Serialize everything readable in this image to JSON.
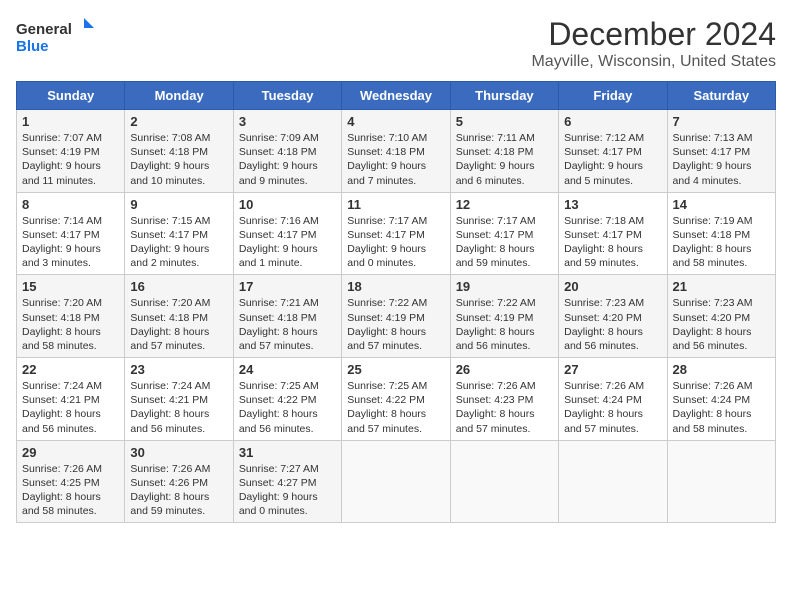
{
  "header": {
    "logo_line1": "General",
    "logo_line2": "Blue",
    "title": "December 2024",
    "location": "Mayville, Wisconsin, United States"
  },
  "days_of_week": [
    "Sunday",
    "Monday",
    "Tuesday",
    "Wednesday",
    "Thursday",
    "Friday",
    "Saturday"
  ],
  "weeks": [
    [
      {
        "day": 1,
        "lines": [
          "Sunrise: 7:07 AM",
          "Sunset: 4:19 PM",
          "Daylight: 9 hours",
          "and 11 minutes."
        ]
      },
      {
        "day": 2,
        "lines": [
          "Sunrise: 7:08 AM",
          "Sunset: 4:18 PM",
          "Daylight: 9 hours",
          "and 10 minutes."
        ]
      },
      {
        "day": 3,
        "lines": [
          "Sunrise: 7:09 AM",
          "Sunset: 4:18 PM",
          "Daylight: 9 hours",
          "and 9 minutes."
        ]
      },
      {
        "day": 4,
        "lines": [
          "Sunrise: 7:10 AM",
          "Sunset: 4:18 PM",
          "Daylight: 9 hours",
          "and 7 minutes."
        ]
      },
      {
        "day": 5,
        "lines": [
          "Sunrise: 7:11 AM",
          "Sunset: 4:18 PM",
          "Daylight: 9 hours",
          "and 6 minutes."
        ]
      },
      {
        "day": 6,
        "lines": [
          "Sunrise: 7:12 AM",
          "Sunset: 4:17 PM",
          "Daylight: 9 hours",
          "and 5 minutes."
        ]
      },
      {
        "day": 7,
        "lines": [
          "Sunrise: 7:13 AM",
          "Sunset: 4:17 PM",
          "Daylight: 9 hours",
          "and 4 minutes."
        ]
      }
    ],
    [
      {
        "day": 8,
        "lines": [
          "Sunrise: 7:14 AM",
          "Sunset: 4:17 PM",
          "Daylight: 9 hours",
          "and 3 minutes."
        ]
      },
      {
        "day": 9,
        "lines": [
          "Sunrise: 7:15 AM",
          "Sunset: 4:17 PM",
          "Daylight: 9 hours",
          "and 2 minutes."
        ]
      },
      {
        "day": 10,
        "lines": [
          "Sunrise: 7:16 AM",
          "Sunset: 4:17 PM",
          "Daylight: 9 hours",
          "and 1 minute."
        ]
      },
      {
        "day": 11,
        "lines": [
          "Sunrise: 7:17 AM",
          "Sunset: 4:17 PM",
          "Daylight: 9 hours",
          "and 0 minutes."
        ]
      },
      {
        "day": 12,
        "lines": [
          "Sunrise: 7:17 AM",
          "Sunset: 4:17 PM",
          "Daylight: 8 hours",
          "and 59 minutes."
        ]
      },
      {
        "day": 13,
        "lines": [
          "Sunrise: 7:18 AM",
          "Sunset: 4:17 PM",
          "Daylight: 8 hours",
          "and 59 minutes."
        ]
      },
      {
        "day": 14,
        "lines": [
          "Sunrise: 7:19 AM",
          "Sunset: 4:18 PM",
          "Daylight: 8 hours",
          "and 58 minutes."
        ]
      }
    ],
    [
      {
        "day": 15,
        "lines": [
          "Sunrise: 7:20 AM",
          "Sunset: 4:18 PM",
          "Daylight: 8 hours",
          "and 58 minutes."
        ]
      },
      {
        "day": 16,
        "lines": [
          "Sunrise: 7:20 AM",
          "Sunset: 4:18 PM",
          "Daylight: 8 hours",
          "and 57 minutes."
        ]
      },
      {
        "day": 17,
        "lines": [
          "Sunrise: 7:21 AM",
          "Sunset: 4:18 PM",
          "Daylight: 8 hours",
          "and 57 minutes."
        ]
      },
      {
        "day": 18,
        "lines": [
          "Sunrise: 7:22 AM",
          "Sunset: 4:19 PM",
          "Daylight: 8 hours",
          "and 57 minutes."
        ]
      },
      {
        "day": 19,
        "lines": [
          "Sunrise: 7:22 AM",
          "Sunset: 4:19 PM",
          "Daylight: 8 hours",
          "and 56 minutes."
        ]
      },
      {
        "day": 20,
        "lines": [
          "Sunrise: 7:23 AM",
          "Sunset: 4:20 PM",
          "Daylight: 8 hours",
          "and 56 minutes."
        ]
      },
      {
        "day": 21,
        "lines": [
          "Sunrise: 7:23 AM",
          "Sunset: 4:20 PM",
          "Daylight: 8 hours",
          "and 56 minutes."
        ]
      }
    ],
    [
      {
        "day": 22,
        "lines": [
          "Sunrise: 7:24 AM",
          "Sunset: 4:21 PM",
          "Daylight: 8 hours",
          "and 56 minutes."
        ]
      },
      {
        "day": 23,
        "lines": [
          "Sunrise: 7:24 AM",
          "Sunset: 4:21 PM",
          "Daylight: 8 hours",
          "and 56 minutes."
        ]
      },
      {
        "day": 24,
        "lines": [
          "Sunrise: 7:25 AM",
          "Sunset: 4:22 PM",
          "Daylight: 8 hours",
          "and 56 minutes."
        ]
      },
      {
        "day": 25,
        "lines": [
          "Sunrise: 7:25 AM",
          "Sunset: 4:22 PM",
          "Daylight: 8 hours",
          "and 57 minutes."
        ]
      },
      {
        "day": 26,
        "lines": [
          "Sunrise: 7:26 AM",
          "Sunset: 4:23 PM",
          "Daylight: 8 hours",
          "and 57 minutes."
        ]
      },
      {
        "day": 27,
        "lines": [
          "Sunrise: 7:26 AM",
          "Sunset: 4:24 PM",
          "Daylight: 8 hours",
          "and 57 minutes."
        ]
      },
      {
        "day": 28,
        "lines": [
          "Sunrise: 7:26 AM",
          "Sunset: 4:24 PM",
          "Daylight: 8 hours",
          "and 58 minutes."
        ]
      }
    ],
    [
      {
        "day": 29,
        "lines": [
          "Sunrise: 7:26 AM",
          "Sunset: 4:25 PM",
          "Daylight: 8 hours",
          "and 58 minutes."
        ]
      },
      {
        "day": 30,
        "lines": [
          "Sunrise: 7:26 AM",
          "Sunset: 4:26 PM",
          "Daylight: 8 hours",
          "and 59 minutes."
        ]
      },
      {
        "day": 31,
        "lines": [
          "Sunrise: 7:27 AM",
          "Sunset: 4:27 PM",
          "Daylight: 9 hours",
          "and 0 minutes."
        ]
      },
      null,
      null,
      null,
      null
    ]
  ]
}
